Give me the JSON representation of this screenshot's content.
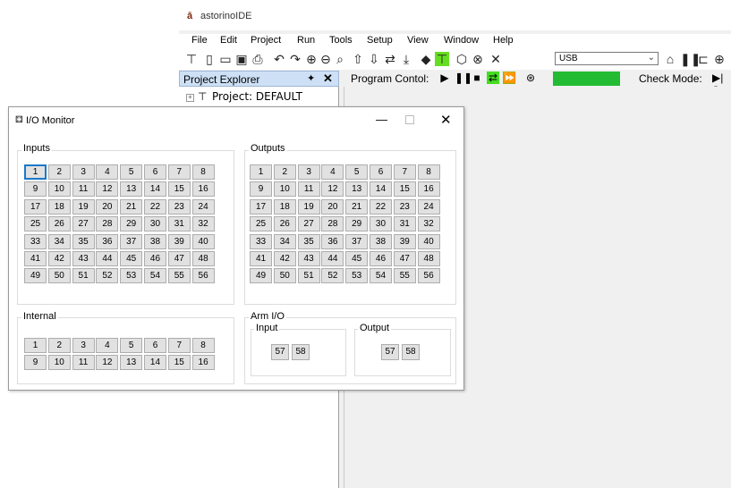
{
  "app": {
    "logo": "ā",
    "title": "astorinoIDE"
  },
  "menu": [
    "File",
    "Edit",
    "Project",
    "Run",
    "Tools",
    "Setup",
    "View",
    "Window",
    "Help"
  ],
  "toolbar": {
    "usb_value": "USB"
  },
  "explorer": {
    "title": "Project Explorer",
    "pin": "✦",
    "close": "✕",
    "expander": "+",
    "project": "Project: DEFAULT"
  },
  "program": {
    "label": "Program Contol:",
    "check_label": "Check Mode:",
    "check_step": "▶|  S"
  },
  "iomonitor": {
    "title": "I/O Monitor",
    "min": "—",
    "close": "✕",
    "inputs_label": "Inputs",
    "outputs_label": "Outputs",
    "internal_label": "Internal",
    "arm_label": "Arm I/O",
    "arm_input_label": "Input",
    "arm_output_label": "Output",
    "inputs": [
      "1",
      "2",
      "3",
      "4",
      "5",
      "6",
      "7",
      "8",
      "9",
      "10",
      "11",
      "12",
      "13",
      "14",
      "15",
      "16",
      "17",
      "18",
      "19",
      "20",
      "21",
      "22",
      "23",
      "24",
      "25",
      "26",
      "27",
      "28",
      "29",
      "30",
      "31",
      "32",
      "33",
      "34",
      "35",
      "36",
      "37",
      "38",
      "39",
      "40",
      "41",
      "42",
      "43",
      "44",
      "45",
      "46",
      "47",
      "48",
      "49",
      "50",
      "51",
      "52",
      "53",
      "54",
      "55",
      "56"
    ],
    "outputs": [
      "1",
      "2",
      "3",
      "4",
      "5",
      "6",
      "7",
      "8",
      "9",
      "10",
      "11",
      "12",
      "13",
      "14",
      "15",
      "16",
      "17",
      "18",
      "19",
      "20",
      "21",
      "22",
      "23",
      "24",
      "25",
      "26",
      "27",
      "28",
      "29",
      "30",
      "31",
      "32",
      "33",
      "34",
      "35",
      "36",
      "37",
      "38",
      "39",
      "40",
      "41",
      "42",
      "43",
      "44",
      "45",
      "46",
      "47",
      "48",
      "49",
      "50",
      "51",
      "52",
      "53",
      "54",
      "55",
      "56"
    ],
    "internal": [
      "1",
      "2",
      "3",
      "4",
      "5",
      "6",
      "7",
      "8",
      "9",
      "10",
      "11",
      "12",
      "13",
      "14",
      "15",
      "16"
    ],
    "arm_inputs": [
      "57",
      "58"
    ],
    "arm_outputs": [
      "57",
      "58"
    ]
  }
}
